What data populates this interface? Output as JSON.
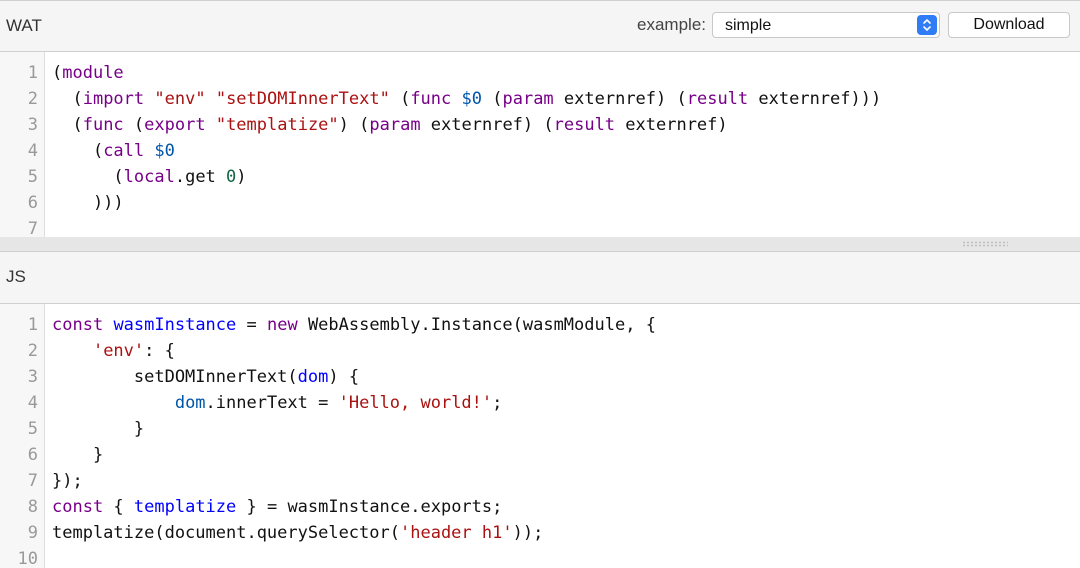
{
  "wat_panel": {
    "title": "WAT",
    "example_label": "example:",
    "example_selected": "simple",
    "download_label": "Download",
    "lines": [
      {
        "num": "1",
        "tokens": [
          {
            "t": "(",
            "c": "plain"
          },
          {
            "t": "module",
            "c": "kw"
          }
        ]
      },
      {
        "num": "2",
        "tokens": [
          {
            "t": "  (",
            "c": "plain"
          },
          {
            "t": "import",
            "c": "kw"
          },
          {
            "t": " ",
            "c": "plain"
          },
          {
            "t": "\"env\"",
            "c": "str"
          },
          {
            "t": " ",
            "c": "plain"
          },
          {
            "t": "\"setDOMInnerText\"",
            "c": "str"
          },
          {
            "t": " (",
            "c": "plain"
          },
          {
            "t": "func",
            "c": "kw"
          },
          {
            "t": " ",
            "c": "plain"
          },
          {
            "t": "$0",
            "c": "var"
          },
          {
            "t": " (",
            "c": "plain"
          },
          {
            "t": "param",
            "c": "kw"
          },
          {
            "t": " externref) (",
            "c": "plain"
          },
          {
            "t": "result",
            "c": "kw"
          },
          {
            "t": " externref)))",
            "c": "plain"
          }
        ]
      },
      {
        "num": "3",
        "tokens": [
          {
            "t": "  (",
            "c": "plain"
          },
          {
            "t": "func",
            "c": "kw"
          },
          {
            "t": " (",
            "c": "plain"
          },
          {
            "t": "export",
            "c": "kw"
          },
          {
            "t": " ",
            "c": "plain"
          },
          {
            "t": "\"templatize\"",
            "c": "str"
          },
          {
            "t": ") (",
            "c": "plain"
          },
          {
            "t": "param",
            "c": "kw"
          },
          {
            "t": " externref) (",
            "c": "plain"
          },
          {
            "t": "result",
            "c": "kw"
          },
          {
            "t": " externref)",
            "c": "plain"
          }
        ]
      },
      {
        "num": "4",
        "tokens": [
          {
            "t": "    (",
            "c": "plain"
          },
          {
            "t": "call",
            "c": "kw"
          },
          {
            "t": " ",
            "c": "plain"
          },
          {
            "t": "$0",
            "c": "var"
          }
        ]
      },
      {
        "num": "5",
        "tokens": [
          {
            "t": "      (",
            "c": "plain"
          },
          {
            "t": "local",
            "c": "kw"
          },
          {
            "t": ".get ",
            "c": "plain"
          },
          {
            "t": "0",
            "c": "num"
          },
          {
            "t": ")",
            "c": "plain"
          }
        ]
      },
      {
        "num": "6",
        "tokens": [
          {
            "t": "    )))",
            "c": "plain"
          }
        ]
      },
      {
        "num": "7",
        "tokens": []
      }
    ]
  },
  "js_panel": {
    "title": "JS",
    "lines": [
      {
        "num": "1",
        "tokens": [
          {
            "t": "const",
            "c": "kw"
          },
          {
            "t": " ",
            "c": "plain"
          },
          {
            "t": "wasmInstance",
            "c": "def"
          },
          {
            "t": " = ",
            "c": "plain"
          },
          {
            "t": "new",
            "c": "kw"
          },
          {
            "t": " WebAssembly.Instance(wasmModule, {",
            "c": "plain"
          }
        ]
      },
      {
        "num": "2",
        "tokens": [
          {
            "t": "    ",
            "c": "plain"
          },
          {
            "t": "'env'",
            "c": "str"
          },
          {
            "t": ": {",
            "c": "plain"
          }
        ]
      },
      {
        "num": "3",
        "tokens": [
          {
            "t": "        setDOMInnerText(",
            "c": "plain"
          },
          {
            "t": "dom",
            "c": "def"
          },
          {
            "t": ") {",
            "c": "plain"
          }
        ]
      },
      {
        "num": "4",
        "tokens": [
          {
            "t": "            ",
            "c": "plain"
          },
          {
            "t": "dom",
            "c": "var"
          },
          {
            "t": ".innerText = ",
            "c": "plain"
          },
          {
            "t": "'Hello, world!'",
            "c": "str"
          },
          {
            "t": ";",
            "c": "plain"
          }
        ]
      },
      {
        "num": "5",
        "tokens": [
          {
            "t": "        }",
            "c": "plain"
          }
        ]
      },
      {
        "num": "6",
        "tokens": [
          {
            "t": "    }",
            "c": "plain"
          }
        ]
      },
      {
        "num": "7",
        "tokens": [
          {
            "t": "});",
            "c": "plain"
          }
        ]
      },
      {
        "num": "8",
        "tokens": [
          {
            "t": "const",
            "c": "kw"
          },
          {
            "t": " { ",
            "c": "plain"
          },
          {
            "t": "templatize",
            "c": "def"
          },
          {
            "t": " } = wasmInstance.exports;",
            "c": "plain"
          }
        ]
      },
      {
        "num": "9",
        "tokens": [
          {
            "t": "templatize(document.querySelector(",
            "c": "plain"
          },
          {
            "t": "'header h1'",
            "c": "str"
          },
          {
            "t": "));",
            "c": "plain"
          }
        ]
      },
      {
        "num": "10",
        "tokens": []
      }
    ]
  },
  "colors": {
    "keyword": "#770088",
    "string": "#aa1111",
    "variable": "#0055aa",
    "number": "#116644",
    "definition": "#0000ff",
    "select_accent": "#2f7cf6"
  },
  "icons": {
    "select_arrows": "chevron-up-down-icon",
    "splitter_grip": "drag-handle-icon"
  }
}
